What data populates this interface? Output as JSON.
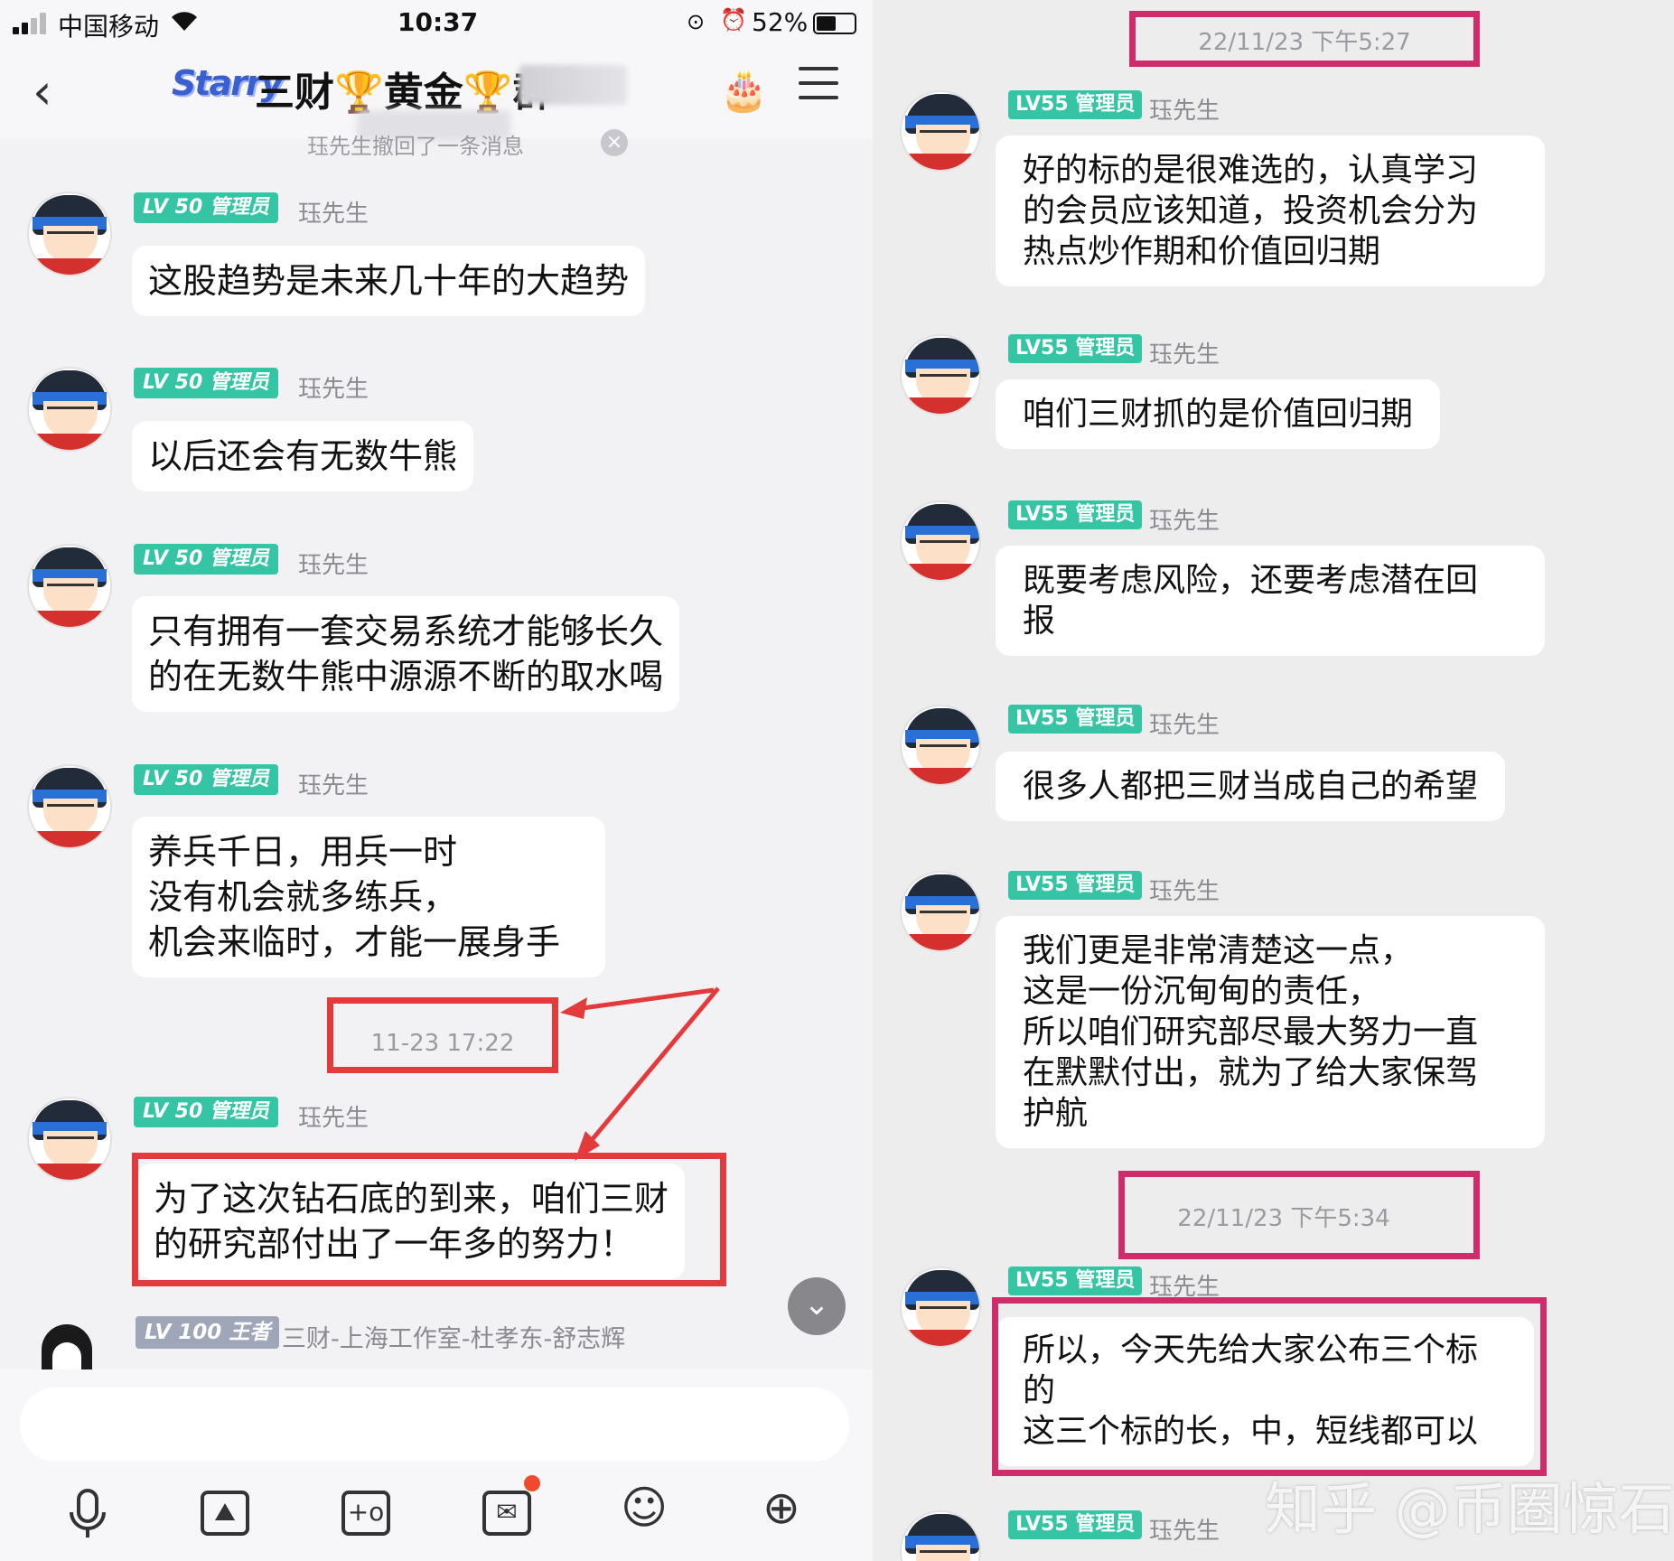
{
  "status_bar": {
    "carrier": "中国移动",
    "time": "10:37",
    "battery": "52%",
    "battery_level": 0.52
  },
  "header": {
    "logo_text": "Starry",
    "title": "三财🏆黄金🏆群"
  },
  "recall_notice": "珏先生撤回了一条消息",
  "left_messages": [
    {
      "level": "LV 50",
      "role": "管理员",
      "sender": "珏先生",
      "text": "这股趋势是未来几十年的大趋势"
    },
    {
      "level": "LV 50",
      "role": "管理员",
      "sender": "珏先生",
      "text": "以后还会有无数牛熊"
    },
    {
      "level": "LV 50",
      "role": "管理员",
      "sender": "珏先生",
      "text": "只有拥有一套交易系统才能够长久\n的在无数牛熊中源源不断的取水喝"
    },
    {
      "level": "LV 50",
      "role": "管理员",
      "sender": "珏先生",
      "text": "养兵千日，用兵一时\n没有机会就多练兵，\n机会来临时，才能一展身手"
    },
    {
      "level": "LV 50",
      "role": "管理员",
      "sender": "珏先生",
      "text": "为了这次钻石底的到来，咱们三财\n的研究部付出了一年多的努力！"
    }
  ],
  "left_timestamp": "11-23 17:22",
  "left_last_sender": {
    "level": "LV 100",
    "role": "王者",
    "sender": "三财-上海工作室-杜孝东-舒志辉"
  },
  "input": {
    "placeholder": ""
  },
  "toolbar": [
    {
      "icon": "microphone-icon",
      "glyph": "🎙"
    },
    {
      "icon": "image-icon",
      "glyph": "⛰"
    },
    {
      "icon": "camera-icon",
      "glyph": "+o"
    },
    {
      "icon": "red-packet-icon",
      "glyph": "✉"
    },
    {
      "icon": "emoji-icon",
      "glyph": "☺"
    },
    {
      "icon": "plus-icon",
      "glyph": "⊕"
    }
  ],
  "right_timestamps": [
    "22/11/23 下午5:27",
    "22/11/23 下午5:34"
  ],
  "right_messages": [
    {
      "level": "LV55",
      "role": "管理员",
      "sender": "珏先生",
      "text": "好的标的是很难选的，认真学习\n的会员应该知道，投资机会分为\n热点炒作期和价值回归期"
    },
    {
      "level": "LV55",
      "role": "管理员",
      "sender": "珏先生",
      "text": "咱们三财抓的是价值回归期"
    },
    {
      "level": "LV55",
      "role": "管理员",
      "sender": "珏先生",
      "text": "既要考虑风险，还要考虑潜在回\n报"
    },
    {
      "level": "LV55",
      "role": "管理员",
      "sender": "珏先生",
      "text": "很多人都把三财当成自己的希望"
    },
    {
      "level": "LV55",
      "role": "管理员",
      "sender": "珏先生",
      "text": "我们更是非常清楚这一点，\n这是一份沉甸甸的责任，\n所以咱们研究部尽最大努力一直\n在默默付出，就为了给大家保驾\n护航"
    },
    {
      "level": "LV55",
      "role": "管理员",
      "sender": "珏先生",
      "text": "所以，今天先给大家公布三个标\n的\n这三个标的长，中，短线都可以"
    },
    {
      "level": "LV55",
      "role": "管理员",
      "sender": "珏先生"
    }
  ],
  "watermark": "知乎 @币圈惊石",
  "colors": {
    "admin_tag": "#35c5a5",
    "king_tag": "#9ea6b8",
    "highlight_red": "#e33b3b",
    "highlight_pink": "#cf2c6c",
    "chat_background": "#f2f2f4",
    "bubble": "#ffffff"
  }
}
